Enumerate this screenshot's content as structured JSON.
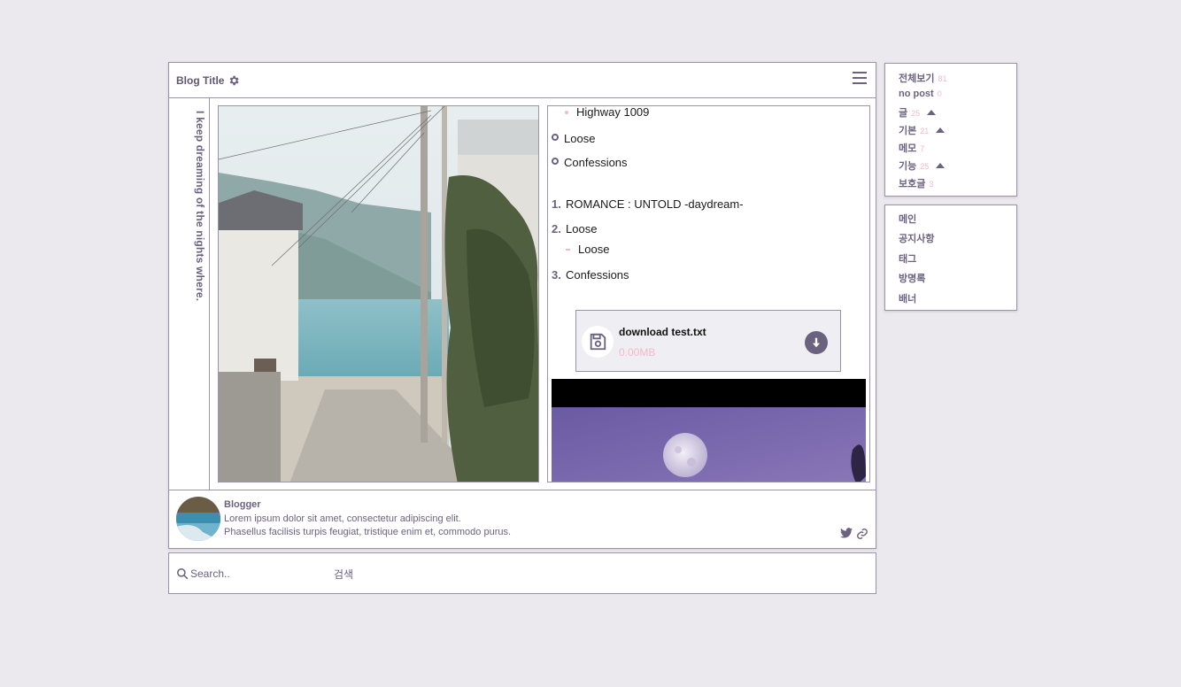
{
  "header": {
    "title": "Blog Title"
  },
  "vertical_text": "I keep dreaming of the nights where.",
  "post": {
    "lines": {
      "highway": "Highway 1009",
      "loose_a": "Loose",
      "confessions_a": "Confessions",
      "n1": "1.",
      "romance": "ROMANCE : UNTOLD -daydream-",
      "n2": "2.",
      "loose_b": "Loose",
      "loose_c": "Loose",
      "n3": "3.",
      "confessions_b": "Confessions"
    },
    "download": {
      "file_name": "download test.txt",
      "size": "0.00MB"
    }
  },
  "profile": {
    "name": "Blogger",
    "line1": "Lorem ipsum dolor sit amet, consectetur adipiscing elit.",
    "line2": "Phasellus facilisis turpis feugiat, tristique enim et, commodo purus."
  },
  "search": {
    "placeholder": "Search..",
    "button_label": "검색"
  },
  "categories": [
    {
      "label": "전체보기",
      "count": "81"
    },
    {
      "label": "no post",
      "count": "0"
    },
    {
      "label": "글",
      "count": "25"
    },
    {
      "label": "기본",
      "count": "21"
    },
    {
      "label": "메모",
      "count": "7"
    },
    {
      "label": "기능",
      "count": "25"
    },
    {
      "label": "보호글",
      "count": "3"
    }
  ],
  "nav": [
    "메인",
    "공지사항",
    "태그",
    "방명록",
    "배너"
  ],
  "colors": {
    "accent": "#6b6280",
    "pink": "#f3b8cc",
    "border": "#9a93ab",
    "background": "#ebe9ed"
  }
}
